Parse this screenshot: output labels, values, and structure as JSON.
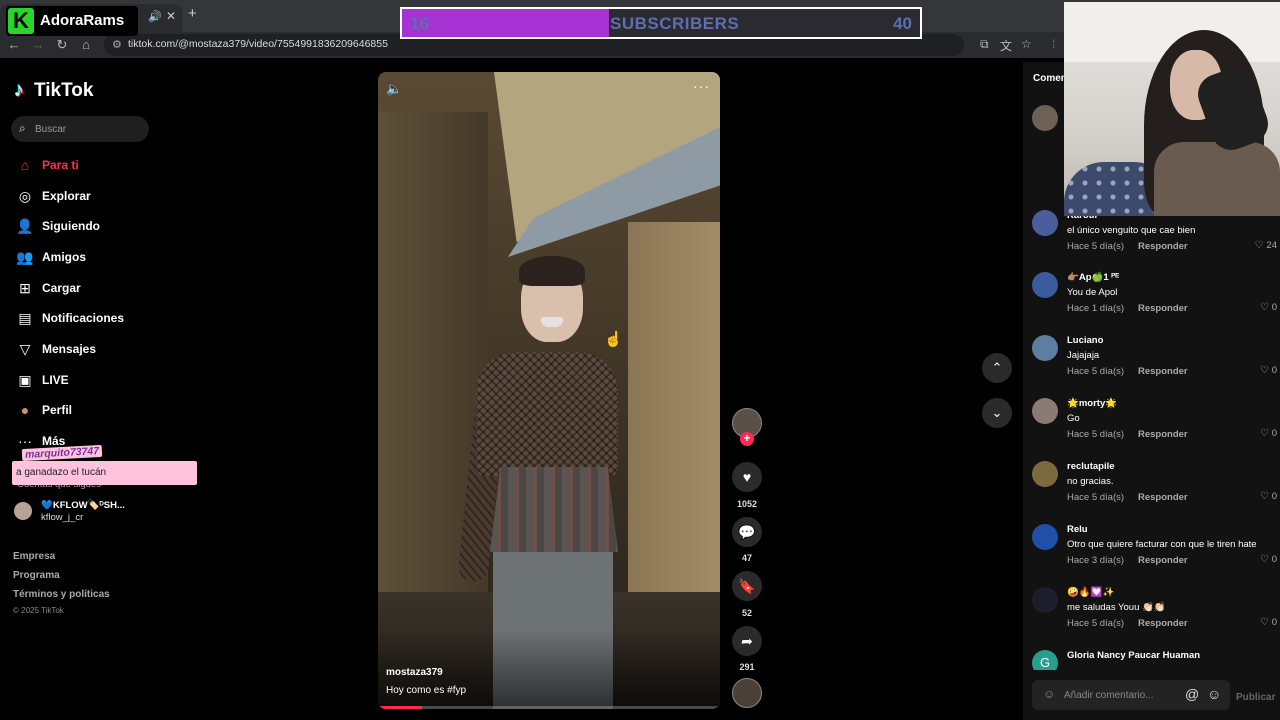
{
  "browser": {
    "url": "tiktok.com/@mostaza379/video/7554991836209646855",
    "tab_mute_icon": "speaker-icon",
    "tab_close_icon": "close-icon",
    "new_tab_icon": "plus-icon"
  },
  "stream_overlay": {
    "logo_letter": "K",
    "channel_name": "AdoraRams",
    "subscribers_current": "16",
    "subscribers_label": "SUBSCRIBERS",
    "subscribers_goal": "40",
    "subscribers_progress": 0.4,
    "chat_username": "marquito73747",
    "chat_message": "a ganadazo el tucán"
  },
  "sidebar": {
    "logo_text": "TikTok",
    "search_placeholder": "Buscar",
    "nav": [
      {
        "label": "Para ti",
        "icon": "home-icon",
        "active": true
      },
      {
        "label": "Explorar",
        "icon": "compass-icon"
      },
      {
        "label": "Siguiendo",
        "icon": "following-icon"
      },
      {
        "label": "Amigos",
        "icon": "friends-icon"
      },
      {
        "label": "Cargar",
        "icon": "upload-icon"
      },
      {
        "label": "Notificaciones",
        "icon": "notifications-icon"
      },
      {
        "label": "Mensajes",
        "icon": "messages-icon"
      },
      {
        "label": "LIVE",
        "icon": "live-icon"
      },
      {
        "label": "Perfil",
        "icon": "profile-avatar-icon"
      },
      {
        "label": "Más",
        "icon": "more-icon"
      }
    ],
    "following_heading": "Cuentas que sigues",
    "following": {
      "name": "💙KFLOW🏷️ᴰSH...",
      "handle": "kflow_j_cr"
    },
    "footer": {
      "company": "Empresa",
      "program": "Programa",
      "terms": "Términos y políticas",
      "copyright": "© 2025 TikTok"
    }
  },
  "video": {
    "author": "mostaza379",
    "caption": "Hoy como es #fyp",
    "progress": 0.13,
    "likes": "1052",
    "comments": "47",
    "saves": "52",
    "shares": "291"
  },
  "comments": {
    "header": "Comentarios",
    "reply_label": "Responder",
    "items": [
      {
        "user": "Karour",
        "text": "el único venguito que cae bien",
        "time": "Hace 5 día(s)",
        "likes": "24",
        "avatar_color": "#4a5e9c"
      },
      {
        "user": "👉🏽Ap🍏1 ᴾᴱ",
        "text": "You de Apol",
        "time": "Hace 1 día(s)",
        "likes": "0",
        "avatar_color": "#3b5b9e"
      },
      {
        "user": "Luciano",
        "text": "Jajajaja",
        "time": "Hace 5 día(s)",
        "likes": "0",
        "avatar_color": "#5f7da0"
      },
      {
        "user": "🌟morty🌟",
        "text": "Go",
        "time": "Hace 5 día(s)",
        "likes": "0",
        "avatar_color": "#8a7b73"
      },
      {
        "user": "reclutapile",
        "text": "no gracias.",
        "time": "Hace 5 día(s)",
        "likes": "0",
        "avatar_color": "#7c6a3e"
      },
      {
        "user": "Relu",
        "text": "Otro que quiere facturar con que le tiren hate",
        "time": "Hace 3 día(s)",
        "likes": "0",
        "avatar_color": "#1f4fa8"
      },
      {
        "user": "🤪🔥💟✨",
        "text": "me saludas Youu 👏🏻👏🏻",
        "time": "Hace 5 día(s)",
        "likes": "0",
        "avatar_color": "#1d1d2b"
      },
      {
        "user": "Gloria Nancy Paucar Huaman",
        "text": "",
        "time": "",
        "likes": "",
        "avatar_letter": "G",
        "avatar_color": "#2a9d8f"
      }
    ],
    "input_placeholder": "Añadir comentario...",
    "publish_label": "Publicar"
  }
}
